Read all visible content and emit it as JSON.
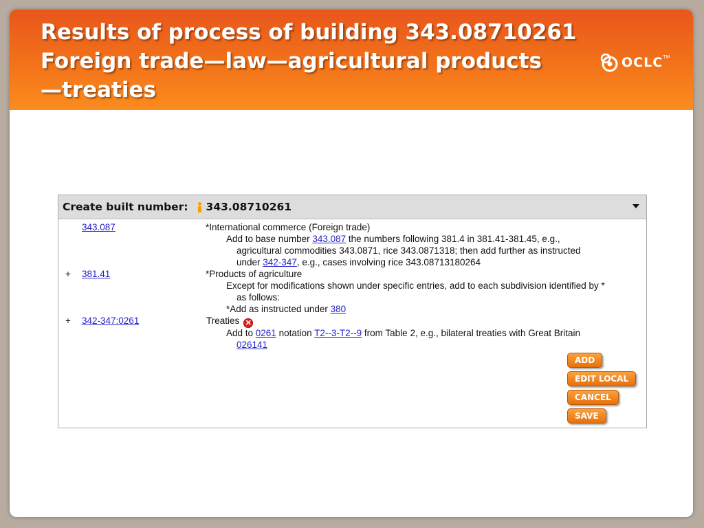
{
  "slide": {
    "title_lines": [
      "Results of process of building 343.08710261",
      "Foreign trade—law—agricultural products",
      "—treaties"
    ],
    "logo": {
      "text": "OCLC",
      "tm": "TM",
      "icon": "oclc-logo-icon"
    }
  },
  "panel": {
    "header_label": "Create built number:",
    "built_number": "343.08710261",
    "icons": {
      "info": "info-icon",
      "dropdown": "caret-down-icon",
      "error": "error-circle-icon"
    },
    "rows": [
      {
        "plus": "",
        "number": "343.087",
        "lines": [
          {
            "parts": [
              "*International commerce (Foreign trade)"
            ]
          },
          {
            "parts": [
              "Add to base number ",
              "343.087",
              " the numbers following 381.4 in 381.41-381.45, e.g.,"
            ]
          },
          {
            "parts": [
              "agricultural commodities 343.0871, rice 343.0871318; then add further as instructed"
            ]
          },
          {
            "parts": [
              "under ",
              "342-347",
              ", e.g., cases involving rice 343.08713180264"
            ]
          }
        ]
      },
      {
        "plus": "+",
        "number": "381.41",
        "lines": [
          {
            "parts": [
              "*Products of agriculture"
            ]
          },
          {
            "parts": [
              "Except for modifications shown under specific entries, add to each subdivision identified by *"
            ]
          },
          {
            "parts": [
              "as follows:"
            ]
          },
          {
            "parts": [
              "*Add as instructed under ",
              "380"
            ]
          }
        ]
      },
      {
        "plus": "+",
        "number": "342-347:0261",
        "lines": [
          {
            "parts": [
              "Treaties"
            ]
          },
          {
            "parts": [
              "Add to ",
              "0261",
              " notation ",
              "T2--3-T2--9",
              " from Table 2, e.g., bilateral treaties with Great Britain"
            ]
          },
          {
            "parts": [
              "026141"
            ]
          }
        ]
      }
    ],
    "buttons": {
      "add": "ADD",
      "edit_local": "EDIT LOCAL",
      "cancel": "CANCEL",
      "save": "SAVE"
    }
  },
  "colors": {
    "header_top": "#e8561c",
    "header_bottom": "#fb8c1e",
    "link": "#2222cc",
    "button": "#f08a1e",
    "error": "#dd2222",
    "info": "#f5a000"
  }
}
